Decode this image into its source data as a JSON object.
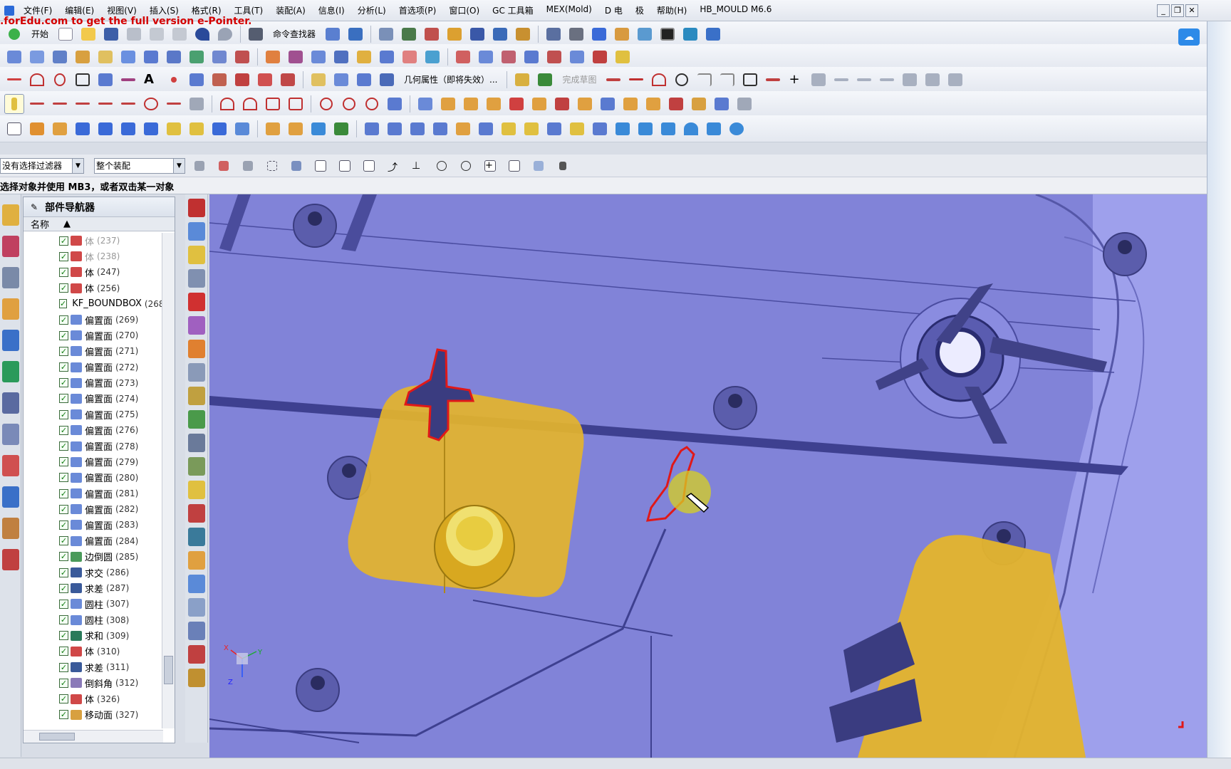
{
  "menu": {
    "items": [
      "文件(F)",
      "编辑(E)",
      "视图(V)",
      "插入(S)",
      "格式(R)",
      "工具(T)",
      "装配(A)",
      "信息(I)",
      "分析(L)",
      "首选项(P)",
      "窗口(O)",
      "GC 工具箱",
      "MEX(Mold)",
      "D 电",
      "极",
      "帮助(H)",
      "HB_MOULD M6.6"
    ],
    "window_controls": [
      "_",
      "❐",
      "✕"
    ]
  },
  "watermark": ".forEdu.com to get the full version e-Pointer.",
  "toolbar": {
    "start_label": "开始",
    "command_finder_label": "命令查找器",
    "geometry_props_label": "几何属性（即将失效）...",
    "finish_sketch_label": "完成草图"
  },
  "selection_bar": {
    "filter_value": "没有选择过滤器",
    "scope_value": "整个装配"
  },
  "cue_line": "选择对象并使用 MB3，或者双击某一对象",
  "navigator": {
    "title": "部件导航器",
    "column_name": "名称",
    "rows": [
      {
        "label": "体",
        "id": "(237)",
        "icon": "body-icon",
        "dim": true
      },
      {
        "label": "体",
        "id": "(238)",
        "icon": "body-icon",
        "dim": true
      },
      {
        "label": "体",
        "id": "(247)",
        "icon": "body-icon",
        "dim": false
      },
      {
        "label": "体",
        "id": "(256)",
        "icon": "body-icon",
        "dim": false
      },
      {
        "label": "KF_BOUNDBOX",
        "id": "(268",
        "icon": "boundbox-icon",
        "dim": false
      },
      {
        "label": "偏置面",
        "id": "(269)",
        "icon": "offset-face-icon",
        "dim": false
      },
      {
        "label": "偏置面",
        "id": "(270)",
        "icon": "offset-face-icon",
        "dim": false
      },
      {
        "label": "偏置面",
        "id": "(271)",
        "icon": "offset-face-icon",
        "dim": false
      },
      {
        "label": "偏置面",
        "id": "(272)",
        "icon": "offset-face-icon",
        "dim": false
      },
      {
        "label": "偏置面",
        "id": "(273)",
        "icon": "offset-face-icon",
        "dim": false
      },
      {
        "label": "偏置面",
        "id": "(274)",
        "icon": "offset-face-icon",
        "dim": false
      },
      {
        "label": "偏置面",
        "id": "(275)",
        "icon": "offset-face-icon",
        "dim": false
      },
      {
        "label": "偏置面",
        "id": "(276)",
        "icon": "offset-face-icon",
        "dim": false
      },
      {
        "label": "偏置面",
        "id": "(278)",
        "icon": "offset-face-icon",
        "dim": false
      },
      {
        "label": "偏置面",
        "id": "(279)",
        "icon": "offset-face-icon",
        "dim": false
      },
      {
        "label": "偏置面",
        "id": "(280)",
        "icon": "offset-face-icon",
        "dim": false
      },
      {
        "label": "偏置面",
        "id": "(281)",
        "icon": "offset-face-icon",
        "dim": false
      },
      {
        "label": "偏置面",
        "id": "(282)",
        "icon": "offset-face-icon",
        "dim": false
      },
      {
        "label": "偏置面",
        "id": "(283)",
        "icon": "offset-face-icon",
        "dim": false
      },
      {
        "label": "偏置面",
        "id": "(284)",
        "icon": "offset-face-icon",
        "dim": false
      },
      {
        "label": "边倒圆",
        "id": "(285)",
        "icon": "edge-blend-icon",
        "dim": false
      },
      {
        "label": "求交",
        "id": "(286)",
        "icon": "intersect-icon",
        "dim": false
      },
      {
        "label": "求差",
        "id": "(287)",
        "icon": "subtract-icon",
        "dim": false
      },
      {
        "label": "圆柱",
        "id": "(307)",
        "icon": "cylinder-icon",
        "dim": false
      },
      {
        "label": "圆柱",
        "id": "(308)",
        "icon": "cylinder-icon",
        "dim": false
      },
      {
        "label": "求和",
        "id": "(309)",
        "icon": "unite-icon",
        "dim": false
      },
      {
        "label": "体",
        "id": "(310)",
        "icon": "body-icon",
        "dim": false
      },
      {
        "label": "求差",
        "id": "(311)",
        "icon": "subtract-icon",
        "dim": false
      },
      {
        "label": "倒斜角",
        "id": "(312)",
        "icon": "chamfer-icon",
        "dim": false
      },
      {
        "label": "体",
        "id": "(326)",
        "icon": "body-icon",
        "dim": false
      },
      {
        "label": "移动面",
        "id": "(327)",
        "icon": "move-face-icon",
        "dim": false
      }
    ],
    "check_glyph": "✓"
  },
  "viewport": {
    "triad_labels": {
      "x": "X",
      "y": "Y",
      "z": "Z"
    }
  },
  "colors": {
    "model_surface": "#8486dc",
    "insert_gold": "#e8b830",
    "markup_red": "#e01818",
    "highlight_yellow": "#d8d020"
  }
}
